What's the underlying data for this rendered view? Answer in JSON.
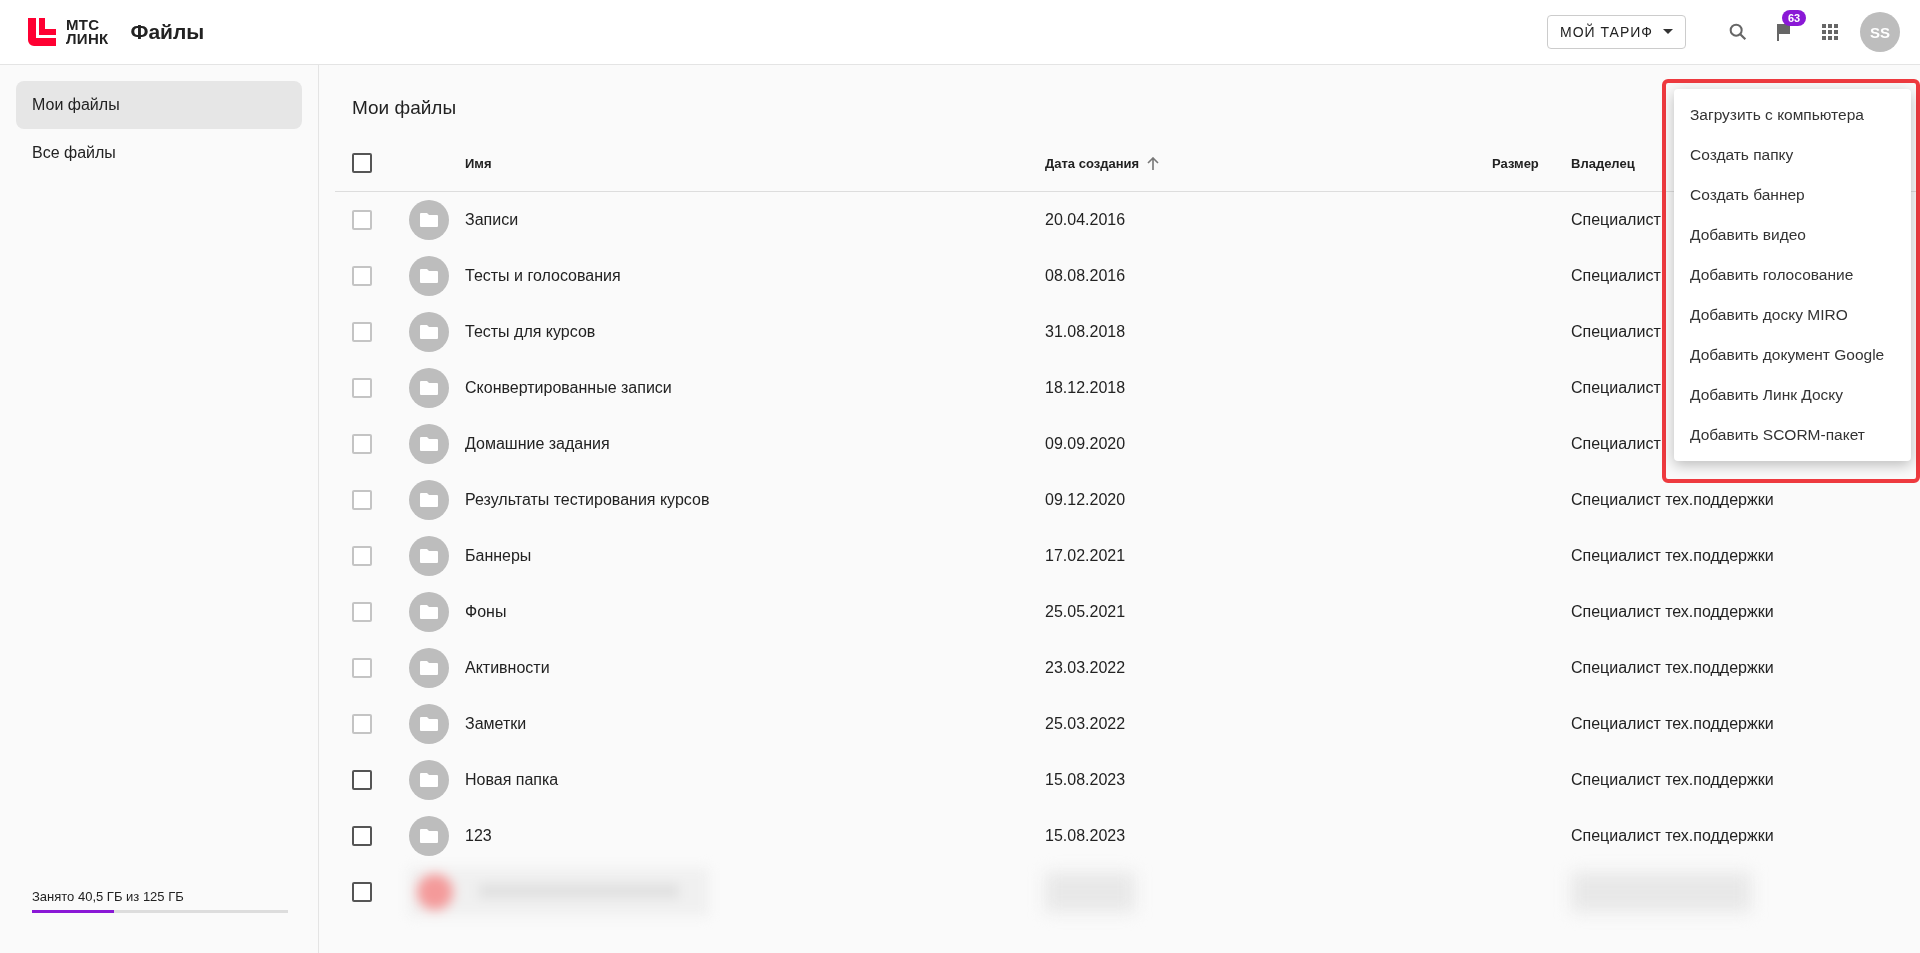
{
  "header": {
    "logo_top": "МТС",
    "logo_bottom": "ЛИНК",
    "title": "Файлы",
    "tariff_button": "МОЙ ТАРИФ",
    "notifications_badge": "63",
    "avatar": "SS"
  },
  "sidebar": {
    "items": [
      {
        "label": "Мои файлы",
        "selected": true
      },
      {
        "label": "Все файлы",
        "selected": false
      }
    ],
    "storage": {
      "text": "Занято 40,5 ГБ из 125 ГБ",
      "level": 0.32
    }
  },
  "main": {
    "title": "Мои файлы",
    "select_all": {
      "checked": false
    },
    "table": {
      "columns": [
        {
          "label": "Имя",
          "sorted": false
        },
        {
          "label": "Дата создания",
          "sorted": true
        },
        {
          "label": "Размер",
          "sorted": false
        },
        {
          "label": "Владелец",
          "sorted": false
        }
      ],
      "rows": [
        {
          "kind": "folder",
          "name": "Записи",
          "date": "20.04.2016",
          "owner": "Специалист",
          "disabled": true
        },
        {
          "kind": "folder",
          "name": "Тесты и голосования",
          "date": "08.08.2016",
          "owner": "Специалист",
          "disabled": true
        },
        {
          "kind": "folder",
          "name": "Тесты для курсов",
          "date": "31.08.2018",
          "owner": "Специалист",
          "disabled": true
        },
        {
          "kind": "folder",
          "name": "Сконвертированные записи",
          "date": "18.12.2018",
          "owner": "Специалист",
          "disabled": true
        },
        {
          "kind": "folder",
          "name": "Домашние задания",
          "date": "09.09.2020",
          "owner": "Специалист",
          "disabled": true
        },
        {
          "kind": "folder",
          "name": "Результаты тестирования курсов",
          "date": "09.12.2020",
          "owner": "Специалист тех.поддержки",
          "disabled": true
        },
        {
          "kind": "folder",
          "name": "Баннеры",
          "date": "17.02.2021",
          "owner": "Специалист тех.поддержки",
          "disabled": true
        },
        {
          "kind": "folder",
          "name": "Фоны",
          "date": "25.05.2021",
          "owner": "Специалист тех.поддержки",
          "disabled": true
        },
        {
          "kind": "folder",
          "name": "Активности",
          "date": "23.03.2022",
          "owner": "Специалист тех.поддержки",
          "disabled": true
        },
        {
          "kind": "folder",
          "name": "Заметки",
          "date": "25.03.2022",
          "owner": "Специалист тех.поддержки",
          "disabled": true
        },
        {
          "kind": "folder",
          "name": "Новая папка",
          "date": "15.08.2023",
          "owner": "Специалист тех.поддержки",
          "disabled": false
        },
        {
          "kind": "folder",
          "name": "123",
          "date": "15.08.2023",
          "owner": "Специалист тех.поддержки",
          "disabled": false
        },
        {
          "kind": "blurred",
          "disabled": false
        }
      ]
    }
  },
  "menu": {
    "highlighted": true,
    "items": [
      "Загрузить с компьютера",
      "Создать папку",
      "Создать баннер",
      "Добавить видео",
      "Добавить голосование",
      "Добавить доску MIRO",
      "Добавить документ Google",
      "Добавить Линк Доску",
      "Добавить SCORM-пакет"
    ]
  }
}
